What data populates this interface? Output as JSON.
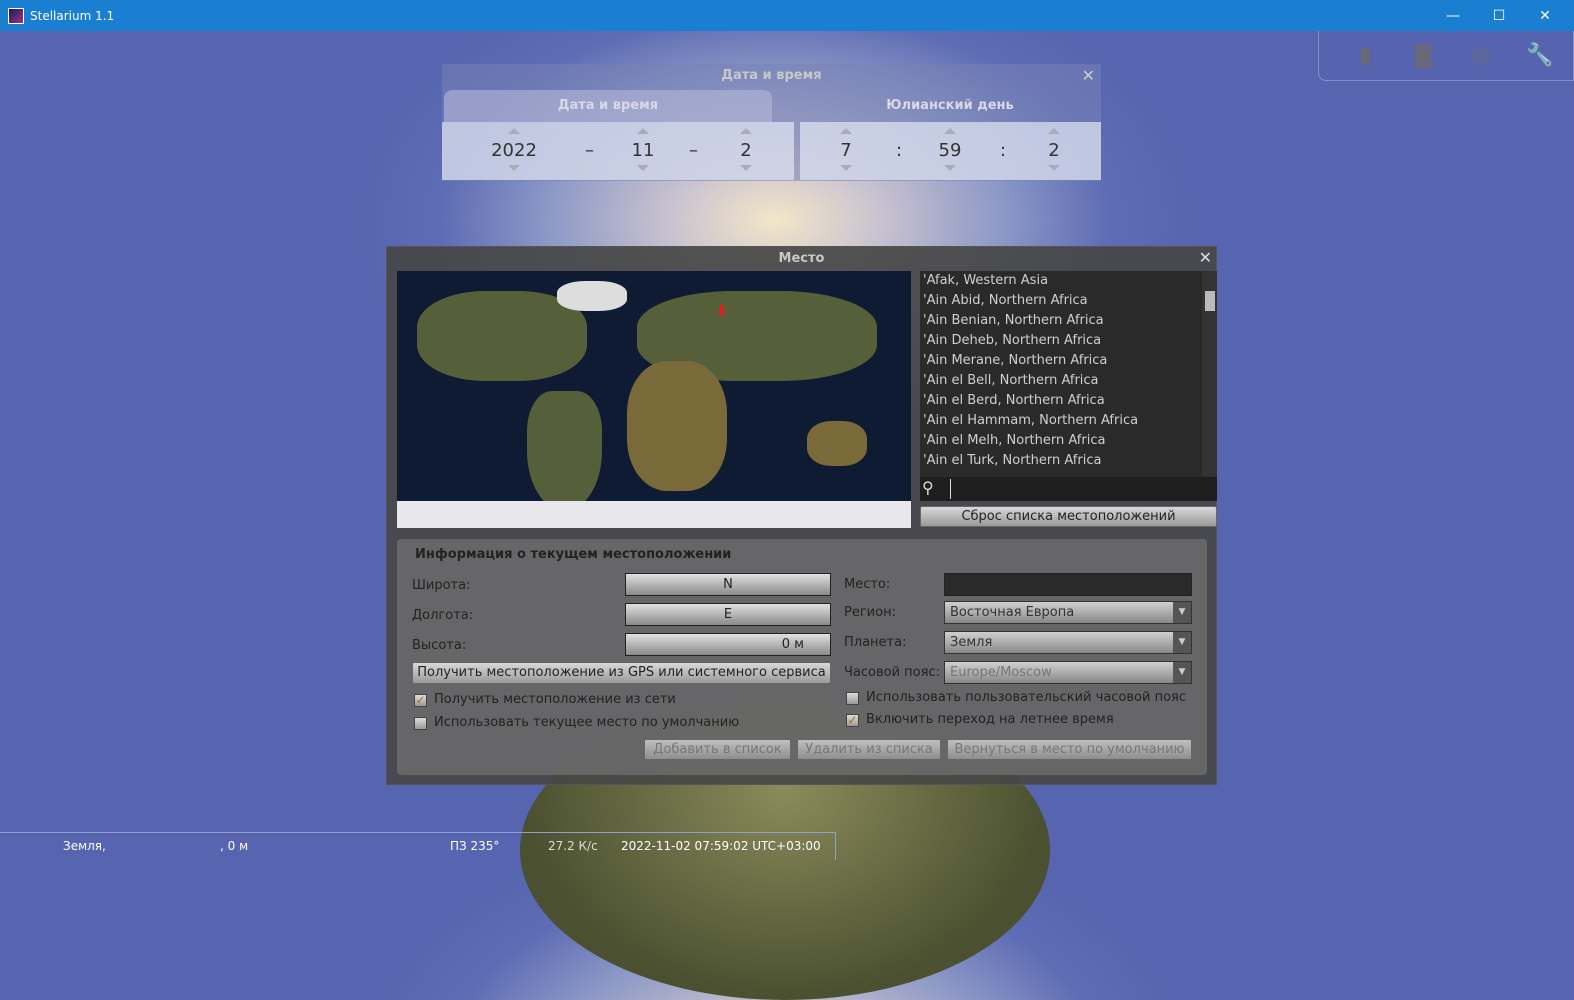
{
  "window": {
    "title": "Stellarium 1.1",
    "minimize": "—",
    "maximize": "☐",
    "close": "✕"
  },
  "datetime_dialog": {
    "title": "Дата и время",
    "tabs": [
      "Дата и время",
      "Юлианский день"
    ],
    "date": {
      "year": "2022",
      "month": "11",
      "day": "2",
      "sep": "–"
    },
    "time": {
      "hour": "7",
      "minute": "59",
      "second": "2",
      "sep": ":"
    }
  },
  "location_dialog": {
    "title": "Место",
    "locations": [
      "'Afak, Western Asia",
      "'Ain Abid, Northern Africa",
      "'Ain Benian, Northern Africa",
      "'Ain Deheb, Northern Africa",
      "'Ain Merane, Northern Africa",
      "'Ain el Bell, Northern Africa",
      "'Ain el Berd, Northern Africa",
      "'Ain el Hammam, Northern Africa",
      "'Ain el Melh, Northern Africa",
      "'Ain el Turk, Northern Africa"
    ],
    "search_value": "",
    "reset_list_button": "Сброс списка местоположений",
    "info": {
      "heading": "Информация о текущем местоположении",
      "latitude_label": "Широта:",
      "latitude_value": "N",
      "longitude_label": "Долгота:",
      "longitude_value": "E",
      "altitude_label": "Высота:",
      "altitude_value": "0 м",
      "gps_button": "Получить местоположение из GPS или системного сервиса",
      "net_checkbox": "Получить местоположение из сети",
      "net_checked": true,
      "default_checkbox": "Использовать текущее место по умолчанию",
      "default_checked": false,
      "place_label": "Место:",
      "place_value": "",
      "region_label": "Регион:",
      "region_value": "Восточная Европа",
      "planet_label": "Планета:",
      "planet_value": "Земля",
      "tz_label": "Часовой пояс:",
      "tz_value": "Europe/Moscow",
      "custom_tz_checkbox": "Использовать пользовательский часовой пояс",
      "custom_tz_checked": false,
      "dst_checkbox": "Включить переход на летнее время",
      "dst_checked": true,
      "add_button": "Добавить в список",
      "delete_button": "Удалить из списка",
      "return_button": "Вернуться в место по умолчанию"
    }
  },
  "status_bar": {
    "planet": "Земля,",
    "altitude": ", 0 м",
    "fov": "ПЗ 235°",
    "fps": "27.2 К/с",
    "datetime": "2022-11-02 07:59:02 UTC+03:00"
  }
}
